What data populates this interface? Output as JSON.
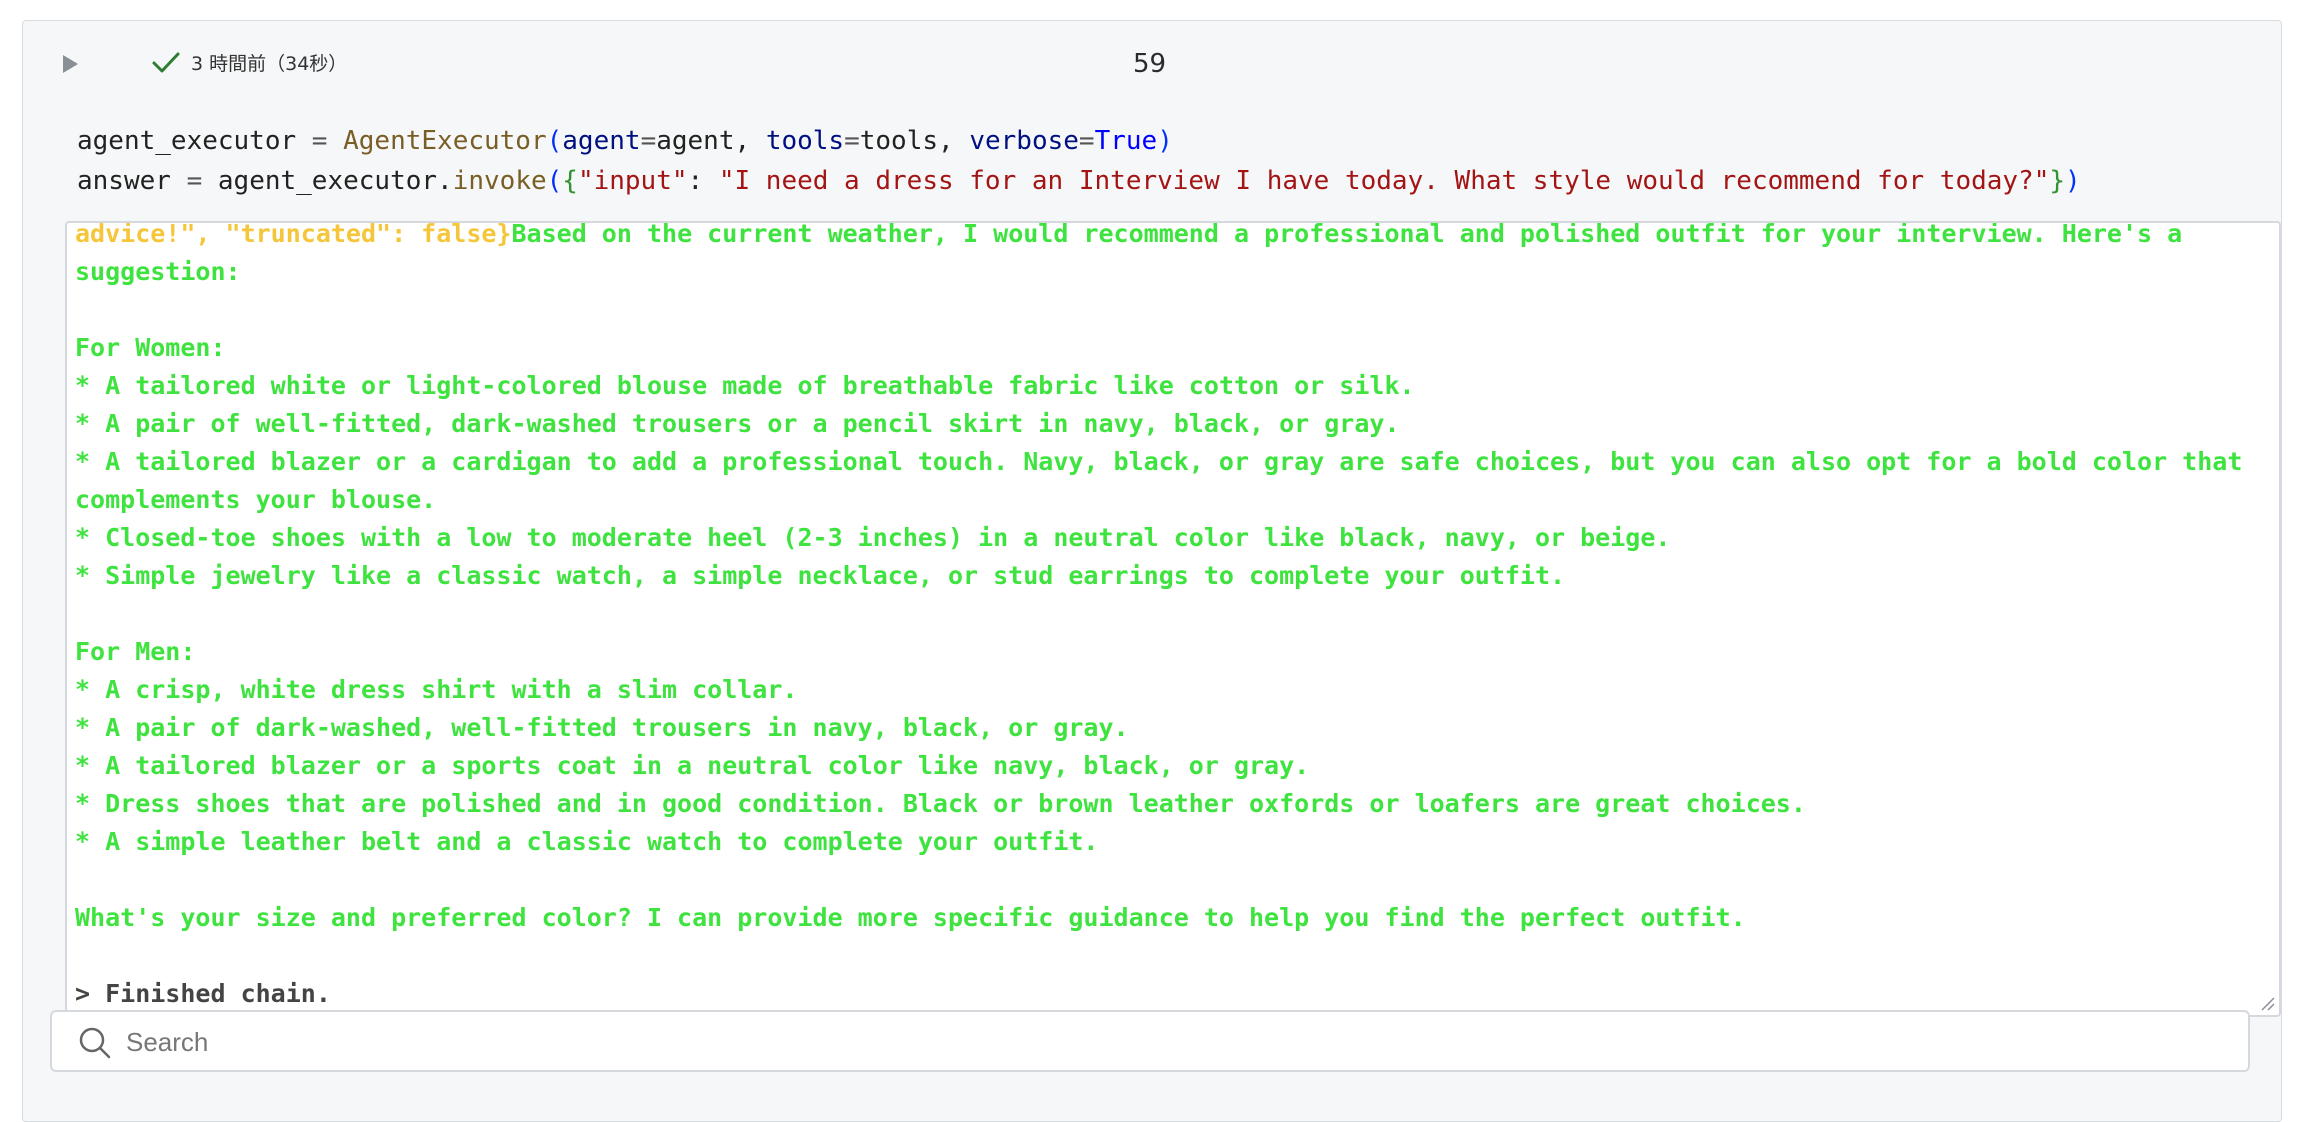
{
  "cell": {
    "status_text": "3 時間前（34秒）",
    "execution_count": "59",
    "code_lines": {
      "line1": {
        "var": "agent_executor",
        "eq": " = ",
        "cls": "AgentExecutor",
        "open": "(",
        "k1": "agent",
        "e1": "=",
        "v1": "agent",
        "c1": ", ",
        "k2": "tools",
        "e2": "=",
        "v2": "tools",
        "c2": ", ",
        "k3": "verbose",
        "e3": "=",
        "v3": "True",
        "close": ")"
      },
      "line2": {
        "var": "answer",
        "eq": " = ",
        "obj": "agent_executor",
        "dot": ".",
        "fn": "invoke",
        "open": "(",
        "brace_open": "{",
        "key": "\"input\"",
        "colon": ": ",
        "value": "\"I need a dress for an Interview I have today. What style would recommend for today?\"",
        "brace_close": "}",
        "close": ")"
      }
    },
    "output": {
      "json_tail": "advice!\", \"truncated\": false}",
      "text": "Based on the current weather, I would recommend a professional and polished outfit for your interview. Here's a suggestion:\n\nFor Women:\n* A tailored white or light-colored blouse made of breathable fabric like cotton or silk.\n* A pair of well-fitted, dark-washed trousers or a pencil skirt in navy, black, or gray.\n* A tailored blazer or a cardigan to add a professional touch. Navy, black, or gray are safe choices, but you can also opt for a bold color that complements your blouse.\n* Closed-toe shoes with a low to moderate heel (2-3 inches) in a neutral color like black, navy, or beige.\n* Simple jewelry like a classic watch, a simple necklace, or stud earrings to complete your outfit.\n\nFor Men:\n* A crisp, white dress shirt with a slim collar.\n* A pair of dark-washed, well-fitted trousers in navy, black, or gray.\n* A tailored blazer or a sports coat in a neutral color like navy, black, or gray.\n* Dress shoes that are polished and in good condition. Black or brown leather oxfords or loafers are great choices.\n* A simple leather belt and a classic watch to complete your outfit.\n\nWhat's your size and preferred color? I can provide more specific guidance to help you find the perfect outfit.\n\n",
      "finished": "> Finished chain."
    }
  },
  "search": {
    "placeholder": "Search"
  },
  "colors": {
    "output_green": "#3fe33f",
    "json_yellow": "#f5c53a",
    "check_green": "#2e7d32"
  },
  "icons": {
    "run": "play-icon",
    "status": "check-icon",
    "search": "search-icon",
    "resize": "resize-handle-icon"
  }
}
